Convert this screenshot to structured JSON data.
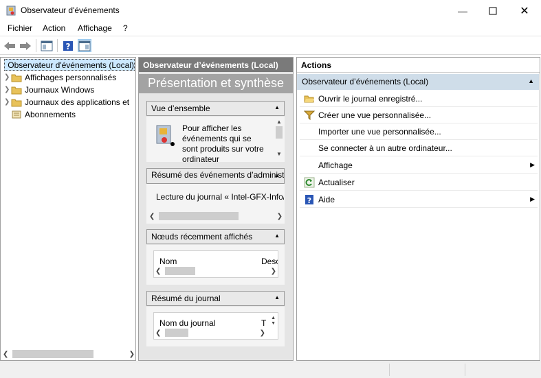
{
  "window": {
    "title": "Observateur d'événements"
  },
  "menu": [
    "Fichier",
    "Action",
    "Affichage",
    "?"
  ],
  "tree": {
    "items": [
      "Observateur d'événements (Local)",
      "Affichages personnalisés",
      "Journaux Windows",
      "Journaux des applications et",
      "Abonnements"
    ]
  },
  "middle": {
    "header": "Observateur d’événements (Local)",
    "subheader": "Présentation et synthèse",
    "overview": {
      "title": "Vue d’ensemble",
      "text": "Pour afficher les événements qui se sont produits sur votre ordinateur"
    },
    "admin_summary": {
      "title": "Résumé des événements d’administration",
      "line": "Lecture du journal « Intel-GFX-Info/..."
    },
    "recent_nodes": {
      "title": "Nœuds récemment affichés",
      "col1": "Nom",
      "col2": "Desc"
    },
    "log_summary": {
      "title": "Résumé du journal",
      "col1": "Nom du journal",
      "col2": "T"
    }
  },
  "actions": {
    "title": "Actions",
    "section": "Observateur d’événements (Local)",
    "items": [
      "Ouvrir le journal enregistré...",
      "Créer une vue personnalisée...",
      "Importer une vue personnalisée...",
      "Se connecter à un autre ordinateur...",
      "Affichage",
      "Actualiser",
      "Aide"
    ]
  }
}
